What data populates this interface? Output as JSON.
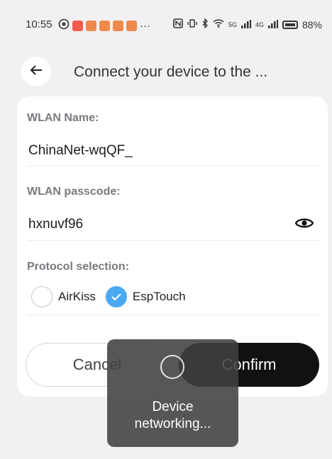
{
  "status_bar": {
    "time": "10:55",
    "more": "···",
    "net_gen_1": "5G",
    "net_gen_2": "4G",
    "battery": "88%"
  },
  "header": {
    "back_icon": "arrow-left-icon",
    "title": "Connect your device to the ..."
  },
  "form": {
    "wlan_name": {
      "label": "WLAN Name:",
      "value": "ChinaNet-wqQF_"
    },
    "wlan_passcode": {
      "label": "WLAN passcode:",
      "value": "hxnuvf96",
      "toggle_icon": "eye-icon"
    },
    "protocol": {
      "label": "Protocol selection:",
      "options": [
        {
          "label": "AirKiss",
          "selected": false
        },
        {
          "label": "EspTouch",
          "selected": true
        }
      ]
    }
  },
  "actions": {
    "cancel": "Cancel",
    "confirm": "Confirm"
  },
  "toast": {
    "message": "Device networking..."
  },
  "colors": {
    "accent": "#4aa9f1",
    "confirm_bg": "#111111",
    "overlay_bg": "#404040"
  }
}
